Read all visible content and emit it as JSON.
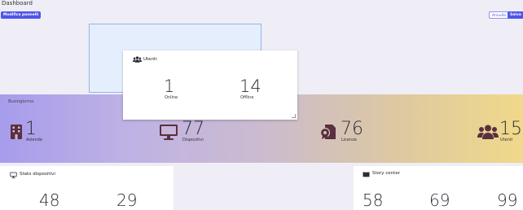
{
  "header": {
    "title": "Dashboard",
    "edit_button": "Modifica pannelli",
    "cancel_button": "Annulla",
    "save_button": "Salva"
  },
  "popup": {
    "title": "Utenti",
    "stats": [
      {
        "value": "1",
        "label": "Online"
      },
      {
        "value": "14",
        "label": "Offline"
      }
    ]
  },
  "banner": {
    "greeting": "Buongiorno",
    "stats": [
      {
        "value": "1",
        "label": "Aziende",
        "icon": "building-icon"
      },
      {
        "value": "77",
        "label": "Dispositivi",
        "icon": "monitor-icon"
      },
      {
        "value": "76",
        "label": "Licenze",
        "icon": "license-icon"
      },
      {
        "value": "15",
        "label": "Utenti",
        "icon": "users-icon"
      }
    ]
  },
  "device_status": {
    "title": "Stato dispositivi",
    "values": [
      "48",
      "29"
    ]
  },
  "story_center": {
    "title": "Story center",
    "values": [
      "58",
      "69",
      "99"
    ]
  },
  "colors": {
    "primary": "#4f55e8",
    "icon": "#5a2f3f"
  }
}
